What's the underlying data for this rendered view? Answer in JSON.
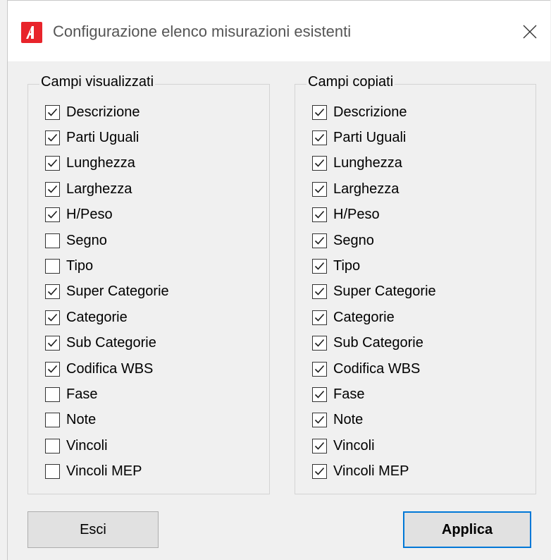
{
  "window": {
    "title": "Configurazione elenco misurazioni esistenti",
    "app_icon": "autodesk-style-A-icon",
    "accent_color": "#e8242b"
  },
  "groups": [
    {
      "legend": "Campi visualizzati",
      "fields": [
        {
          "label": "Descrizione",
          "checked": true
        },
        {
          "label": "Parti Uguali",
          "checked": true
        },
        {
          "label": "Lunghezza",
          "checked": true
        },
        {
          "label": "Larghezza",
          "checked": true
        },
        {
          "label": "H/Peso",
          "checked": true
        },
        {
          "label": "Segno",
          "checked": false
        },
        {
          "label": "Tipo",
          "checked": false
        },
        {
          "label": "Super Categorie",
          "checked": true
        },
        {
          "label": "Categorie",
          "checked": true
        },
        {
          "label": "Sub Categorie",
          "checked": true
        },
        {
          "label": "Codifica WBS",
          "checked": true
        },
        {
          "label": "Fase",
          "checked": false
        },
        {
          "label": "Note",
          "checked": false
        },
        {
          "label": "Vincoli",
          "checked": false
        },
        {
          "label": "Vincoli MEP",
          "checked": false
        }
      ]
    },
    {
      "legend": "Campi copiati",
      "fields": [
        {
          "label": "Descrizione",
          "checked": true
        },
        {
          "label": "Parti Uguali",
          "checked": true
        },
        {
          "label": "Lunghezza",
          "checked": true
        },
        {
          "label": "Larghezza",
          "checked": true
        },
        {
          "label": "H/Peso",
          "checked": true
        },
        {
          "label": "Segno",
          "checked": true
        },
        {
          "label": "Tipo",
          "checked": true
        },
        {
          "label": "Super Categorie",
          "checked": true
        },
        {
          "label": "Categorie",
          "checked": true
        },
        {
          "label": "Sub Categorie",
          "checked": true
        },
        {
          "label": "Codifica WBS",
          "checked": true
        },
        {
          "label": "Fase",
          "checked": true
        },
        {
          "label": "Note",
          "checked": true
        },
        {
          "label": "Vincoli",
          "checked": true
        },
        {
          "label": "Vincoli MEP",
          "checked": true
        }
      ]
    }
  ],
  "buttons": {
    "exit_label": "Esci",
    "apply_label": "Applica"
  },
  "colors": {
    "default_button_border": "#0078d7"
  }
}
